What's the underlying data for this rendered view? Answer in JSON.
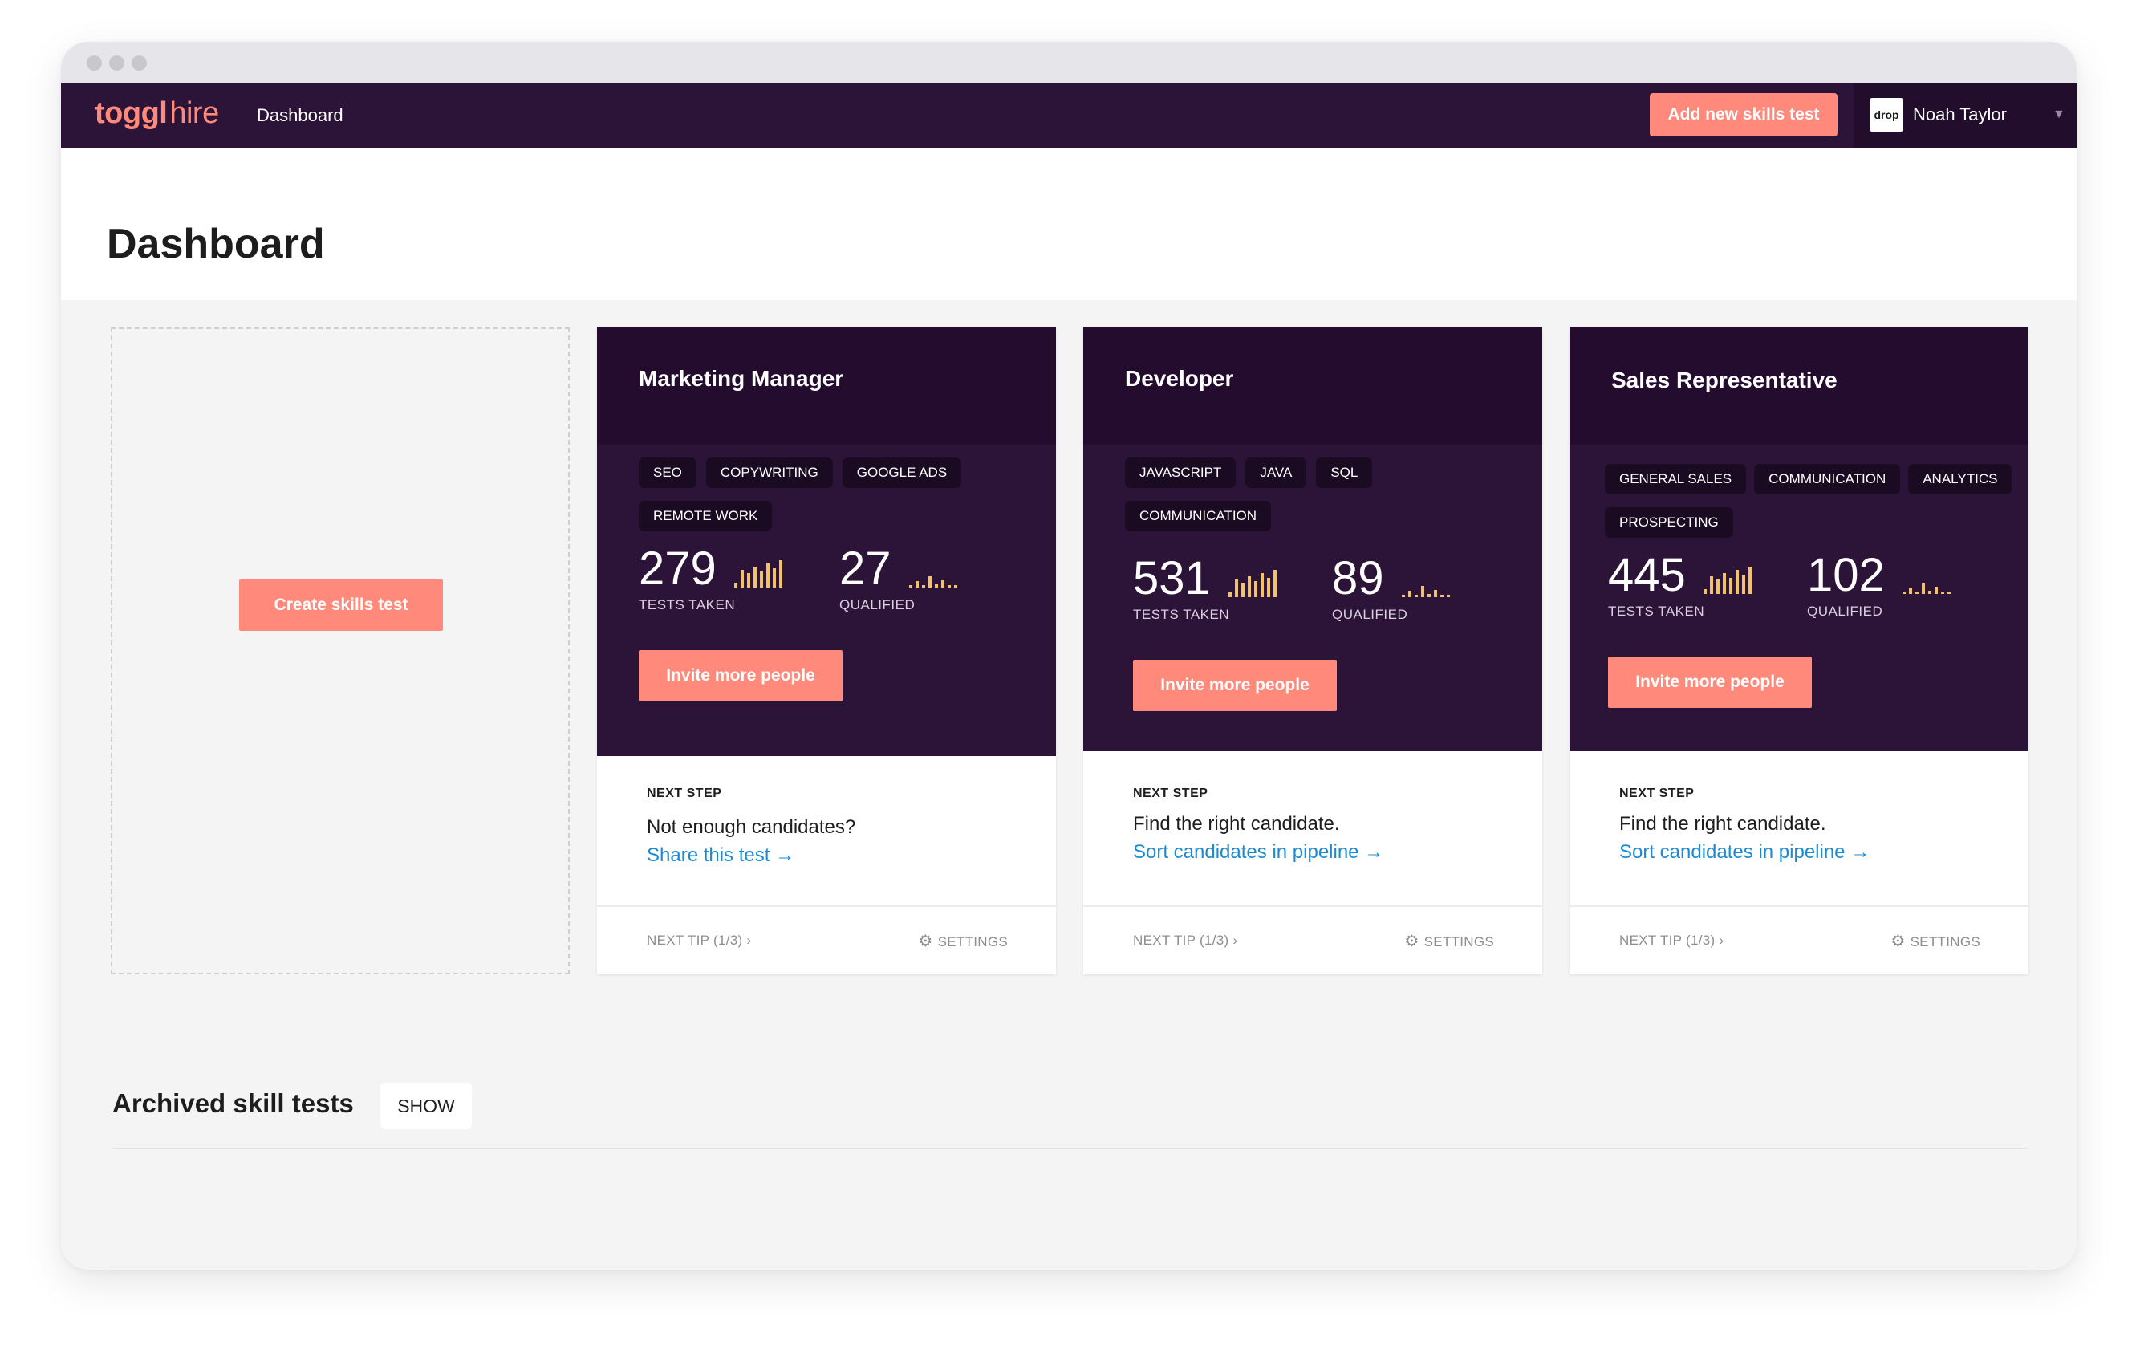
{
  "app": {
    "logo_bold": "toggl",
    "logo_light": "hire"
  },
  "nav": {
    "dashboard": "Dashboard"
  },
  "header": {
    "add_button": "Add new skills test",
    "user_name": "Noah Taylor",
    "avatar_text": "drop"
  },
  "page": {
    "title": "Dashboard",
    "create_button": "Create skills test"
  },
  "cards": [
    {
      "title": "Marketing Manager",
      "tags": [
        "SEO",
        "COPYWRITING",
        "GOOGLE ADS",
        "REMOTE WORK"
      ],
      "tests_taken": "279",
      "tests_taken_label": "TESTS TAKEN",
      "qualified": "27",
      "qualified_label": "QUALIFIED",
      "invite_button": "Invite more people",
      "next_step_label": "NEXT STEP",
      "next_step_text": "Not enough candidates?",
      "next_step_link": "Share this test →",
      "next_tip": "NEXT TIP (1/3) ›",
      "settings": "SETTINGS"
    },
    {
      "title": "Developer",
      "tags": [
        "JAVASCRIPT",
        "JAVA",
        "SQL",
        "COMMUNICATION"
      ],
      "tests_taken": "531",
      "tests_taken_label": "TESTS TAKEN",
      "qualified": "89",
      "qualified_label": "QUALIFIED",
      "invite_button": "Invite more people",
      "next_step_label": "NEXT STEP",
      "next_step_text": "Find the right candidate.",
      "next_step_link": "Sort candidates in pipeline →",
      "next_tip": "NEXT TIP (1/3) ›",
      "settings": "SETTINGS"
    },
    {
      "title": "Sales Representative",
      "tags": [
        "GENERAL SALES",
        "COMMUNICATION",
        "ANALYTICS",
        "PROSPECTING"
      ],
      "tests_taken": "445",
      "tests_taken_label": "TESTS TAKEN",
      "qualified": "102",
      "qualified_label": "QUALIFIED",
      "invite_button": "Invite more people",
      "next_step_label": "NEXT STEP",
      "next_step_text": "Find the right candidate.",
      "next_step_link": "Sort candidates in pipeline →",
      "next_tip": "NEXT TIP (1/3) ›",
      "settings": "SETTINGS"
    }
  ],
  "archived": {
    "title": "Archived skill tests",
    "show_button": "SHOW"
  },
  "icons": {
    "settings": "gear-icon",
    "tests_chart": "bar-chart-icon",
    "qualified_chart": "bar-chart-icon",
    "user_menu": "chevron-down-icon"
  },
  "colors": {
    "navbar": "#2c1338",
    "card_header": "#230c2e",
    "accent": "#ff897a",
    "link": "#1b8ad3",
    "chart_bars": "#f3c267"
  }
}
